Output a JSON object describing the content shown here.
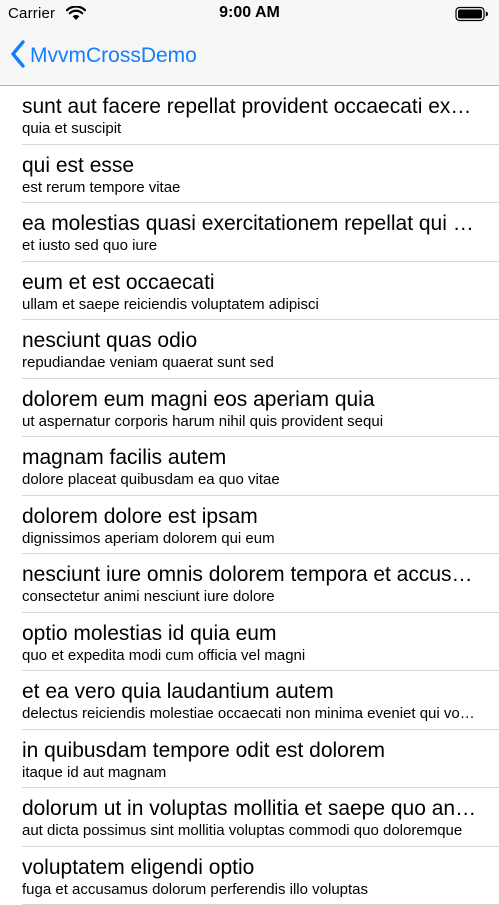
{
  "status_bar": {
    "carrier": "Carrier",
    "time": "9:00 AM",
    "wifi_icon": "wifi-icon",
    "battery_icon": "battery-icon"
  },
  "nav": {
    "back_label": "MvvmCrossDemo",
    "back_icon": "chevron-left-icon",
    "accent_color": "#157efb"
  },
  "posts": [
    {
      "title": "sunt aut facere repellat provident occaecati excepturi optio reprehenderit",
      "body": "quia et suscipit"
    },
    {
      "title": "qui est esse",
      "body": "est rerum tempore vitae"
    },
    {
      "title": "ea molestias quasi exercitationem repellat qui ipsa sit aut",
      "body": "et iusto sed quo iure"
    },
    {
      "title": "eum et est occaecati",
      "body": "ullam et saepe reiciendis voluptatem adipisci"
    },
    {
      "title": "nesciunt quas odio",
      "body": "repudiandae veniam quaerat sunt sed"
    },
    {
      "title": "dolorem eum magni eos aperiam quia",
      "body": "ut aspernatur corporis harum nihil quis provident sequi"
    },
    {
      "title": "magnam facilis autem",
      "body": "dolore placeat quibusdam ea quo vitae"
    },
    {
      "title": "dolorem dolore est ipsam",
      "body": "dignissimos aperiam dolorem qui eum"
    },
    {
      "title": "nesciunt iure omnis dolorem tempora et accusantium",
      "body": "consectetur animi nesciunt iure dolore"
    },
    {
      "title": "optio molestias id quia eum",
      "body": "quo et expedita modi cum officia vel magni"
    },
    {
      "title": "et ea vero quia laudantium autem",
      "body": "delectus reiciendis molestiae occaecati non minima eveniet qui voluptatibus"
    },
    {
      "title": "in quibusdam tempore odit est dolorem",
      "body": "itaque id aut magnam"
    },
    {
      "title": "dolorum ut in voluptas mollitia et saepe quo animi",
      "body": "aut dicta possimus sint mollitia voluptas commodi quo doloremque"
    },
    {
      "title": "voluptatem eligendi optio",
      "body": "fuga et accusamus dolorum perferendis illo voluptas"
    }
  ]
}
